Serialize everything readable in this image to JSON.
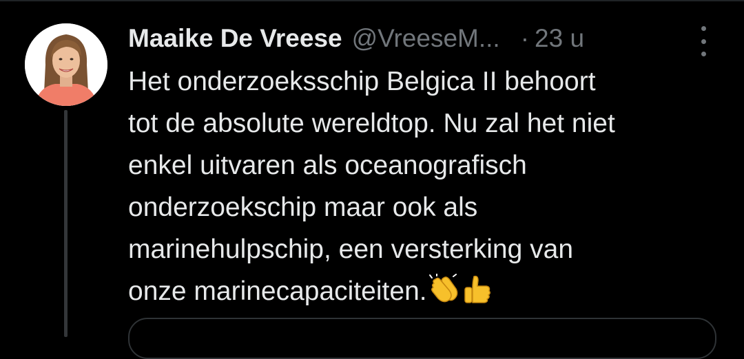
{
  "tweet": {
    "author_name": "Maaike De Vreese",
    "author_handle": "@VreeseM...",
    "separator": "·",
    "timestamp": "23 u",
    "text_lines": [
      "Het onderzoeksschip Belgica II behoort",
      "tot de absolute wereldtop. Nu zal het niet",
      "enkel uitvaren als oceanografisch",
      "onderzoekschip maar ook als",
      "marinehulpschip, een versterking van",
      "onze marinecapaciteiten."
    ],
    "emojis": [
      "clapping-hands",
      "thumbs-up"
    ]
  },
  "colors": {
    "background": "#000000",
    "primary_text": "#e7e9ea",
    "secondary_text": "#71767b",
    "thread_line": "#333639",
    "card_border": "#2f3336"
  },
  "icons": {
    "more": "more-vertical-icon",
    "avatar": "profile-photo"
  }
}
